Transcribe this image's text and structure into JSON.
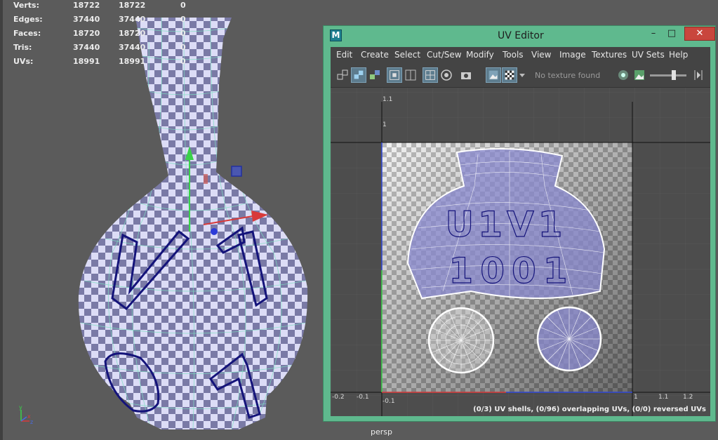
{
  "hud": {
    "rows": [
      {
        "label": "Verts:",
        "v1": "18722",
        "v2": "18722",
        "v3": "0"
      },
      {
        "label": "Edges:",
        "v1": "37440",
        "v2": "37440",
        "v3": "0"
      },
      {
        "label": "Faces:",
        "v1": "18720",
        "v2": "18720",
        "v3": "0"
      },
      {
        "label": "Tris:",
        "v1": "37440",
        "v2": "37440",
        "v3": "0"
      },
      {
        "label": "UVs:",
        "v1": "18991",
        "v2": "18991",
        "v3": "0"
      }
    ]
  },
  "viewport": {
    "camera_label": "persp",
    "axis_y": "y",
    "axis_x": "x",
    "axis_z": "z"
  },
  "model": {
    "decal_top_text": "V1",
    "decal_bottom_text": "01"
  },
  "uv_editor": {
    "app_icon": "M",
    "title": "UV Editor",
    "window_buttons": {
      "minimize": "–",
      "maximize": "□",
      "close": "✕"
    },
    "menus": [
      "Edit",
      "Create",
      "Select",
      "Cut/Sew",
      "Modify",
      "Tools",
      "View",
      "Image",
      "Textures",
      "UV Sets",
      "Help"
    ],
    "texture_status": "No texture found",
    "tick_labels": {
      "x": [
        "-0.2",
        "-0.1",
        "1",
        "1.1",
        "1.2"
      ],
      "y": [
        "1.1",
        "1",
        "-0.1"
      ]
    },
    "shell_text_line1": "U1V1",
    "shell_text_line2": "1001",
    "status": "(0/3) UV shells, (0/96) overlapping UVs, (0/0) reversed UVs"
  },
  "colors": {
    "window_frame": "#5fb98e",
    "close_button": "#c9463d",
    "wireframe": "#7fe0c2",
    "checker_dark": "#7a7aa6",
    "checker_light": "#dcdcf6",
    "decal": "#14137a"
  }
}
